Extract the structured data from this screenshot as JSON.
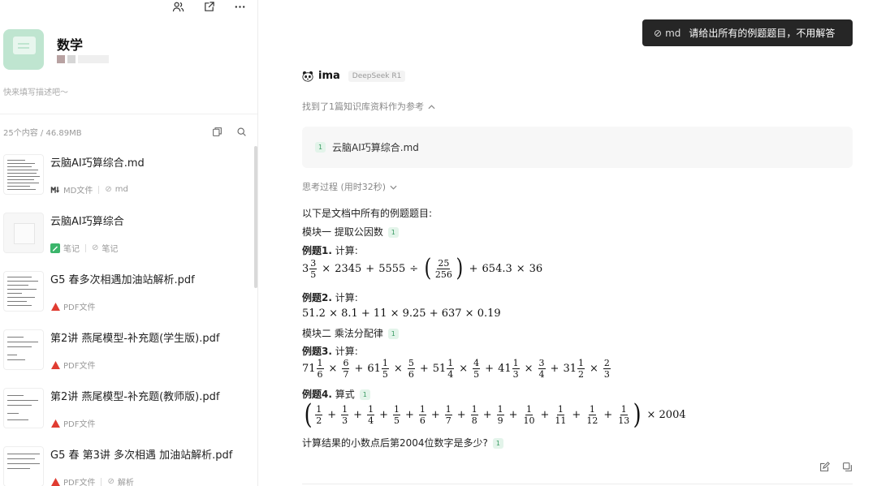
{
  "kb": {
    "title": "数学",
    "description": "快来填写描述吧～",
    "count": "25个内容 / 46.89MB"
  },
  "files": [
    {
      "name": "云脑AI巧算综合.md",
      "type_label": "MD文件",
      "tag": "md",
      "icon": "md-icon"
    },
    {
      "name": "云脑AI巧算综合",
      "type_label": "笔记",
      "tag": "笔记",
      "icon": "note-icon"
    },
    {
      "name": "G5 春多次相遇加油站解析.pdf",
      "type_label": "PDF文件",
      "tag": "",
      "icon": "pdf-icon"
    },
    {
      "name": "第2讲 燕尾模型-补充题(学生版).pdf",
      "type_label": "PDF文件",
      "tag": "",
      "icon": "pdf-icon"
    },
    {
      "name": "第2讲 燕尾模型-补充题(教师版).pdf",
      "type_label": "PDF文件",
      "tag": "",
      "icon": "pdf-icon"
    },
    {
      "name": "G5 春 第3讲 多次相遇 加油站解析.pdf",
      "type_label": "PDF文件",
      "tag": "解析",
      "icon": "pdf-icon"
    }
  ],
  "chat": {
    "user_ref": "md",
    "user_message": "请给出所有的例题题目，不用解答",
    "bot_name": "ima",
    "model": "DeepSeek R1",
    "found_text": "找到了1篇知识库资料作为参考",
    "ref_index": "1",
    "ref_file": "云脑AI巧算综合.md",
    "think_text": "思考过程 (用时32秒)",
    "intro": "以下是文档中所有的例题题目:",
    "module1": "模块一 提取公因数",
    "ex1_label": "例题1.",
    "ex1_text": " 计算:",
    "ex2_label": "例题2.",
    "ex2_text": " 计算:",
    "ex2_expr": "51.2 × 8.1 + 11 × 9.25 + 637 × 0.19",
    "module2": "模块二 乘法分配律",
    "ex3_label": "例题3.",
    "ex3_text": " 计算:",
    "ex4_label": "例题4.",
    "ex4_text": " 算式",
    "ex4_end": "× 2004",
    "final_q": "计算结果的小数点后第2004位数字是多少?",
    "cite": "1"
  },
  "colors": {
    "accent_green": "#3a9b63",
    "pdf_red": "#e03c31",
    "bubble_bg": "#262626"
  }
}
